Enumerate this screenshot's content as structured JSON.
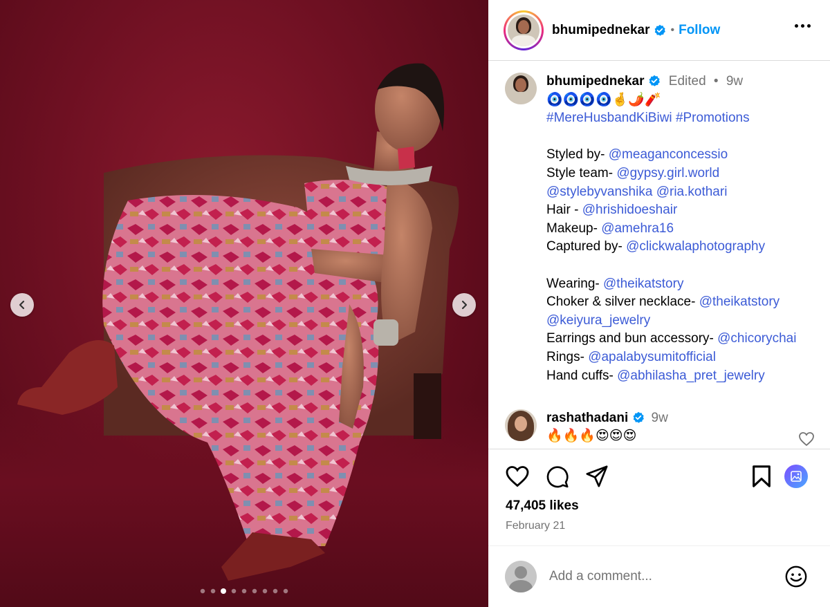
{
  "post": {
    "username": "bhumipednekar",
    "follow_label": "Follow",
    "separator": "•",
    "carousel": {
      "count": 9,
      "active_index": 2
    }
  },
  "caption": {
    "username": "bhumipednekar",
    "edited": "Edited",
    "separator": "•",
    "time": "9w",
    "emoji_line": "🧿🧿🧿🧿🤞🌶️🧨",
    "hashtags": [
      "#MereHusbandKiBiwi",
      "#Promotions"
    ],
    "credits": [
      {
        "label": "Styled by- ",
        "handles": [
          "@meaganconcessio"
        ]
      },
      {
        "label": "Style team- ",
        "handles": [
          "@gypsy.girl.world"
        ]
      },
      {
        "label": "",
        "handles": [
          "@stylebyvanshika",
          "@ria.kothari"
        ]
      },
      {
        "label": "Hair - ",
        "handles": [
          "@hrishidoeshair"
        ]
      },
      {
        "label": "Makeup- ",
        "handles": [
          "@amehra16"
        ]
      },
      {
        "label": "Captured by- ",
        "handles": [
          "@clickwalaphotography"
        ]
      }
    ],
    "wearing": [
      {
        "label": "Wearing- ",
        "handles": [
          "@theikatstory"
        ]
      },
      {
        "label": "Choker & silver necklace- ",
        "handles": [
          "@theikatstory"
        ]
      },
      {
        "label": "",
        "handles": [
          "@keiyura_jewelry"
        ]
      },
      {
        "label": "Earrings and bun accessory- ",
        "handles": [
          "@chicorychai"
        ]
      },
      {
        "label": "Rings- ",
        "handles": [
          "@apalabysumitofficial"
        ]
      },
      {
        "label": "Hand cuffs- ",
        "handles": [
          "@abhilasha_pret_jewelry"
        ]
      }
    ]
  },
  "reply": {
    "username": "rashathadani",
    "time": "9w",
    "text": "🔥🔥🔥😍😍😍"
  },
  "stats": {
    "likes": "47,405 likes",
    "date": "February 21"
  },
  "comment_input": {
    "placeholder": "Add a comment..."
  },
  "colors": {
    "link": "#3c5bd6",
    "follow": "#0095f6",
    "muted": "#737373",
    "background_photo": "#6e1022"
  },
  "icons": [
    "chevron-left-icon",
    "chevron-right-icon",
    "verified-badge-icon",
    "more-options-icon",
    "heart-icon",
    "comment-icon",
    "share-icon",
    "bookmark-icon",
    "gallery-icon",
    "emoji-icon"
  ]
}
